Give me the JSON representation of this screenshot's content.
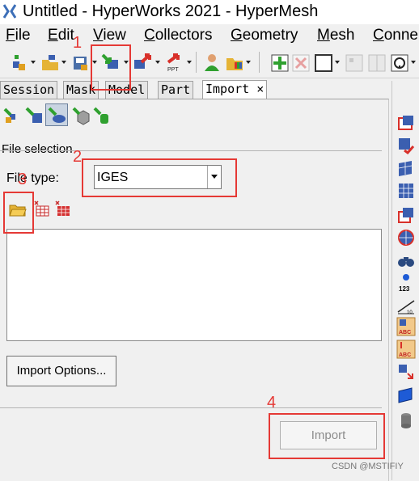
{
  "window": {
    "title": "Untitled - HyperWorks 2021 - HyperMesh"
  },
  "menu": [
    {
      "label": "File",
      "key": "F",
      "rest": "ile"
    },
    {
      "label": "Edit",
      "key": "E",
      "rest": "dit"
    },
    {
      "label": "View",
      "key": "V",
      "rest": "iew"
    },
    {
      "label": "Collectors",
      "key": "C",
      "rest": "ollectors"
    },
    {
      "label": "Geometry",
      "key": "G",
      "rest": "eometry"
    },
    {
      "label": "Mesh",
      "key": "M",
      "rest": "esh"
    },
    {
      "label": "Conne",
      "key": "C",
      "rest": "onne"
    }
  ],
  "toolbar": {
    "ppt_label": "PPT"
  },
  "tabs": [
    "Session",
    "Mask",
    "Model",
    "Part",
    "Import"
  ],
  "tab_close": "×",
  "import_panel": {
    "section_title": "File selection",
    "file_type_label": "File type:",
    "file_type_value": "IGES",
    "file_list": [],
    "import_options_label": "Import Options...",
    "import_label": "Import"
  },
  "right_toolbar": {
    "label_123": "123",
    "label_abc1": "ABC",
    "label_abc2": "ABC",
    "label_ruler": "10"
  },
  "annotations": [
    "1",
    "2",
    "3",
    "4"
  ],
  "watermark": "CSDN @MSTIFIY",
  "colors": {
    "annotation": "#e53935",
    "import_disabled_text": "#8c8c8c",
    "accent_green": "#2fa02f"
  }
}
